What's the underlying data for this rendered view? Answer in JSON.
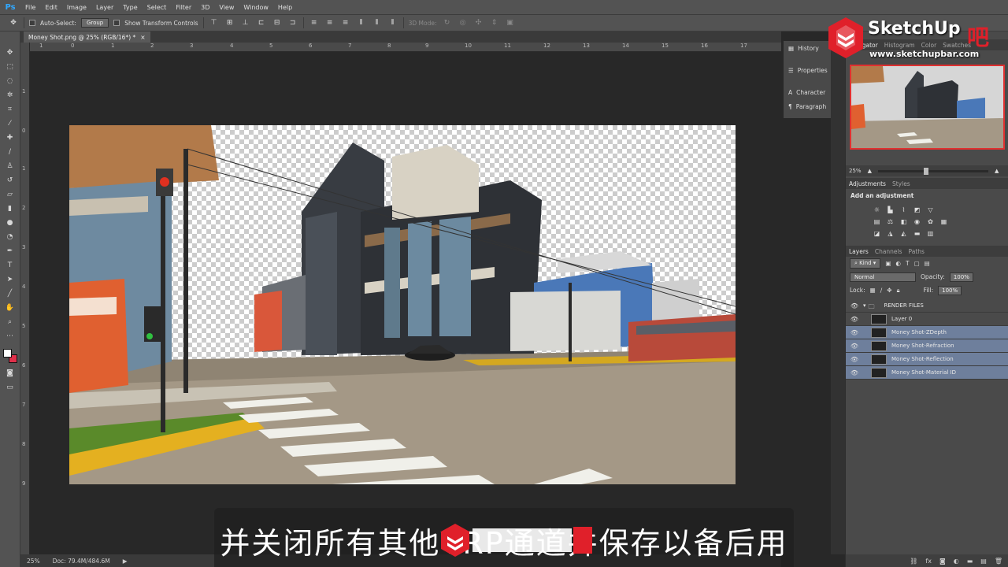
{
  "app": {
    "logo": "Ps"
  },
  "menu": [
    "File",
    "Edit",
    "Image",
    "Layer",
    "Type",
    "Select",
    "Filter",
    "3D",
    "View",
    "Window",
    "Help"
  ],
  "options": {
    "auto_select_label": "Auto-Select:",
    "group_value": "Group",
    "transform_label": "Show Transform Controls",
    "mode_label": "3D Mode:"
  },
  "document": {
    "tab_title": "Money Shot.png @ 25% (RGB/16*) *",
    "close_glyph": "×"
  },
  "rulers": {
    "h": [
      "1",
      "0",
      "1",
      "2",
      "3",
      "4",
      "5",
      "6",
      "7",
      "8",
      "9",
      "10",
      "11",
      "12",
      "13",
      "14",
      "15",
      "16",
      "17"
    ],
    "v": [
      "1",
      "0",
      "1",
      "2",
      "3",
      "4",
      "5",
      "6",
      "7",
      "8",
      "9"
    ]
  },
  "status": {
    "zoom": "25%",
    "doc": "Doc: 79.4M/484.6M"
  },
  "mini_panels": [
    "History",
    "Properties",
    "Character",
    "Paragraph"
  ],
  "navigator": {
    "tabs": [
      "Navigator",
      "Histogram",
      "Color",
      "Swatches"
    ],
    "zoom": "25%"
  },
  "adjustments": {
    "tabs": [
      "Adjustments",
      "Styles"
    ],
    "title": "Add an adjustment"
  },
  "layers": {
    "tabs": [
      "Layers",
      "Channels",
      "Paths"
    ],
    "kind": "Kind",
    "blend": "Normal",
    "opacity_label": "Opacity:",
    "opacity": "100%",
    "lock_label": "Lock:",
    "fill_label": "Fill:",
    "fill": "100%",
    "group": "RENDER FILES",
    "items": [
      {
        "name": "Layer 0",
        "selected": false
      },
      {
        "name": "Money Shot-ZDepth",
        "selected": true
      },
      {
        "name": "Money Shot-Refraction",
        "selected": true
      },
      {
        "name": "Money Shot-Reflection",
        "selected": true
      },
      {
        "name": "Money Shot-Material ID",
        "selected": true
      }
    ]
  },
  "watermark": {
    "brand": "SketchUp",
    "red_char": "吧",
    "url": "www.sketchupbar.com"
  },
  "subtitle": {
    "text": "并关闭所有其他VRP通道并保存以备后用"
  },
  "colors": {
    "accent": "#31a8ff",
    "selection": "#6e7f9c",
    "brand_red": "#e0202a"
  }
}
